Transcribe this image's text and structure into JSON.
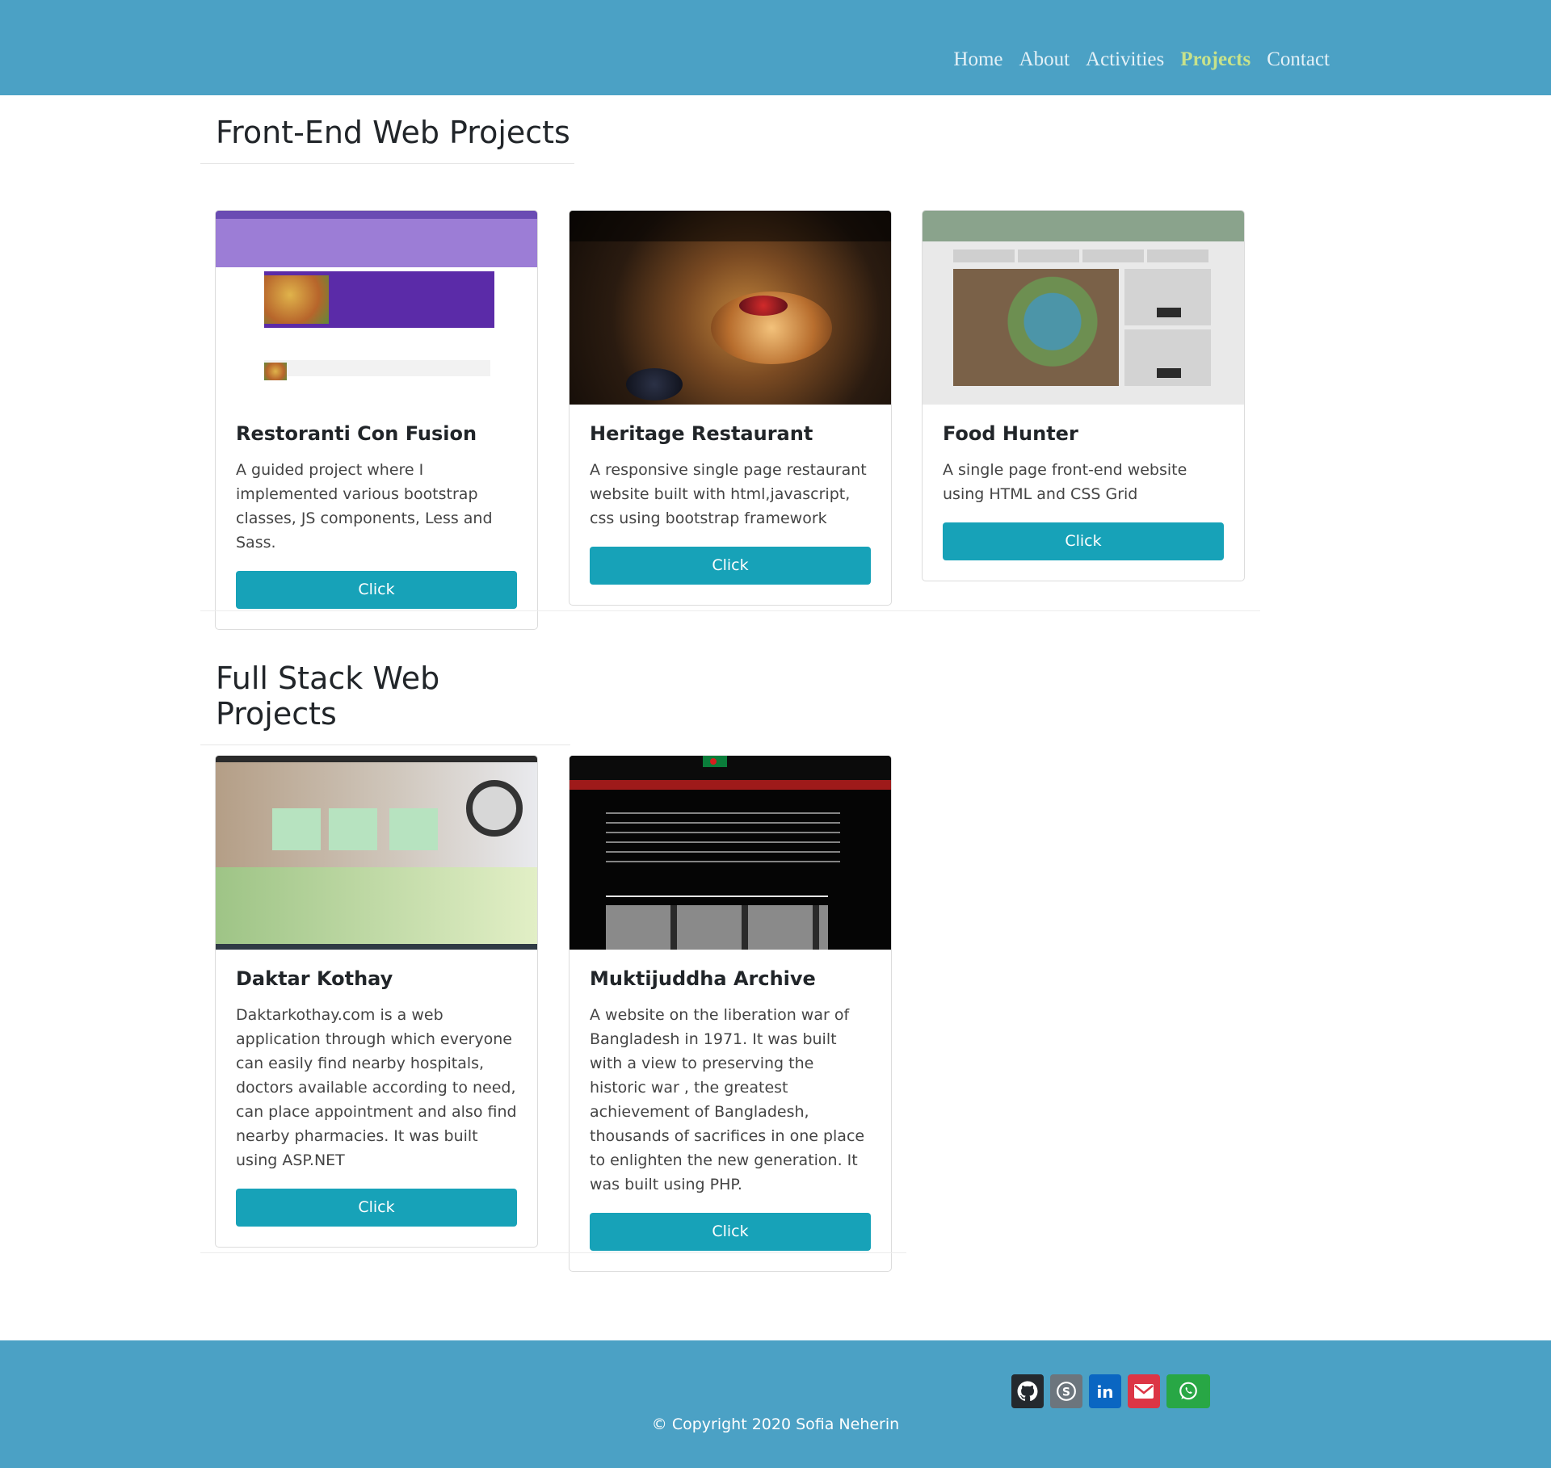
{
  "nav": {
    "home": "Home",
    "about": "About",
    "activities": "Activities",
    "projects": "Projects",
    "contact": "Contact"
  },
  "sections": {
    "frontend_title": "Front-End Web Projects",
    "fullstack_title": "Full Stack Web Projects"
  },
  "frontend": [
    {
      "title": "Restoranti Con Fusion",
      "text": "A guided project where I implemented various bootstrap classes, JS components, Less and Sass.",
      "button": "Click"
    },
    {
      "title": "Heritage Restaurant",
      "text": "A responsive single page restaurant website built with html,javascript, css using bootstrap framework",
      "button": "Click"
    },
    {
      "title": "Food Hunter",
      "text": "A single page front-end website using HTML and CSS Grid",
      "button": "Click"
    }
  ],
  "fullstack": [
    {
      "title": "Daktar Kothay",
      "text": "Daktarkothay.com is a web application through which everyone can easily find nearby hospitals, doctors available according to need, can place appointment and also find nearby pharmacies. It was built using ASP.NET",
      "button": "Click"
    },
    {
      "title": "Muktijuddha Archive",
      "text": "A website on the liberation war of Bangladesh in 1971. It was built with a view to preserving the historic war , the greatest achievement of Bangladesh, thousands of sacrifices in one place to enlighten the new generation. It was built using PHP.",
      "button": "Click"
    }
  ],
  "footer": {
    "copyright": "© Copyright 2020 Sofia Neherin",
    "social_icons": [
      "github-icon",
      "skype-icon",
      "linkedin-icon",
      "email-icon",
      "whatsapp-icon"
    ]
  },
  "colors": {
    "header_bg": "#4ba1c5",
    "accent": "#17a2b8",
    "active_nav": "#c7e28b"
  }
}
